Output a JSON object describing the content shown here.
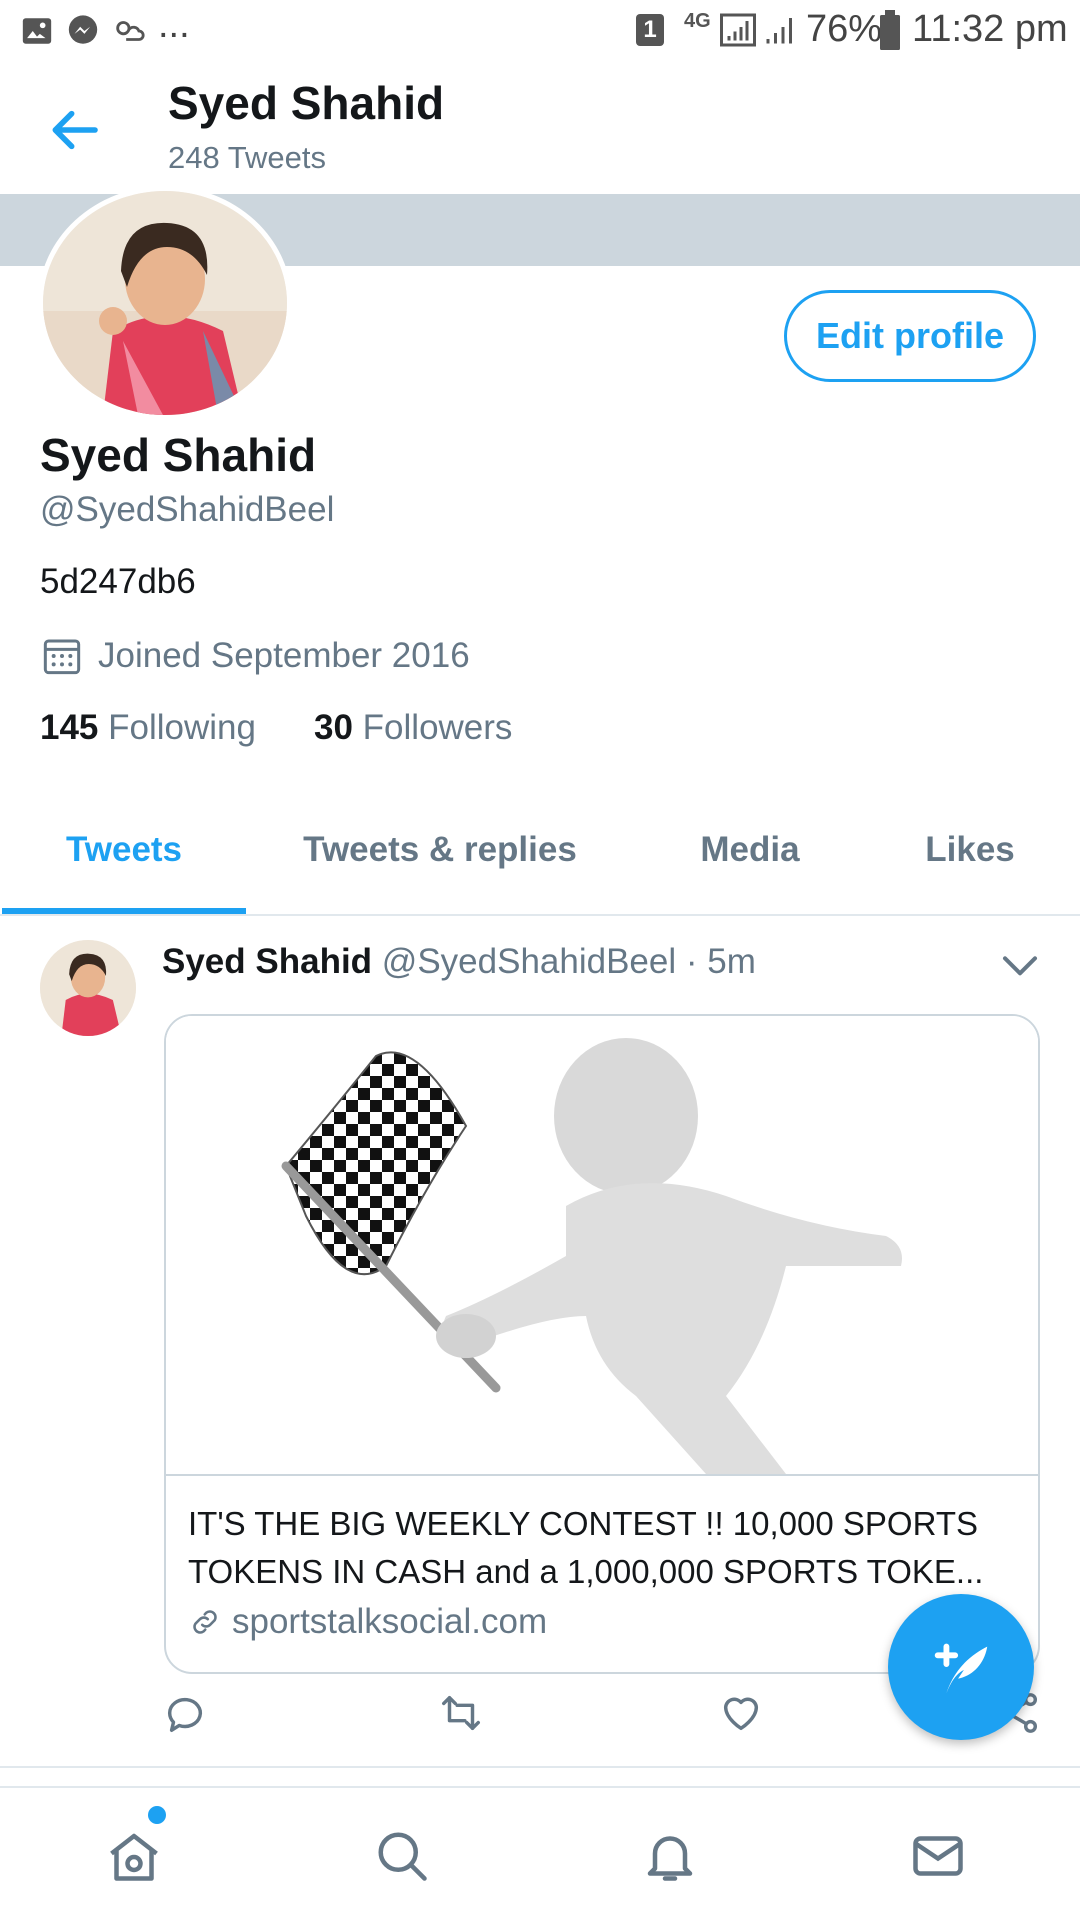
{
  "status_bar": {
    "sim": "1",
    "network": "4G",
    "battery": "76%",
    "time": "11:32 pm",
    "more": "...",
    "icons": [
      "image-icon",
      "messenger-icon",
      "weather-icon",
      "sim-icon",
      "signal-icon",
      "battery-icon"
    ]
  },
  "header": {
    "name": "Syed Shahid",
    "tweet_count": "248 Tweets"
  },
  "profile": {
    "name": "Syed Shahid",
    "handle": "@SyedShahidBeel",
    "bio": "5d247db6",
    "joined": "Joined September 2016",
    "following_count": "145",
    "following_label": "Following",
    "followers_count": "30",
    "followers_label": "Followers",
    "edit_label": "Edit profile"
  },
  "tabs": [
    {
      "label": "Tweets",
      "active": true
    },
    {
      "label": "Tweets & replies",
      "active": false
    },
    {
      "label": "Media",
      "active": false
    },
    {
      "label": "Likes",
      "active": false
    }
  ],
  "tweet": {
    "name": "Syed Shahid",
    "handle": "@SyedShahidBeel",
    "separator": "·",
    "time": "5m",
    "card_title": "IT'S THE BIG WEEKLY CONTEST !! 10,000 SPORTS TOKENS IN CASH and a 1,000,000 SPORTS TOKE...",
    "card_domain": "sportstalksocial.com"
  },
  "colors": {
    "accent": "#1da1f2",
    "banner": "#ccd6dd",
    "secondary_text": "#657786"
  }
}
